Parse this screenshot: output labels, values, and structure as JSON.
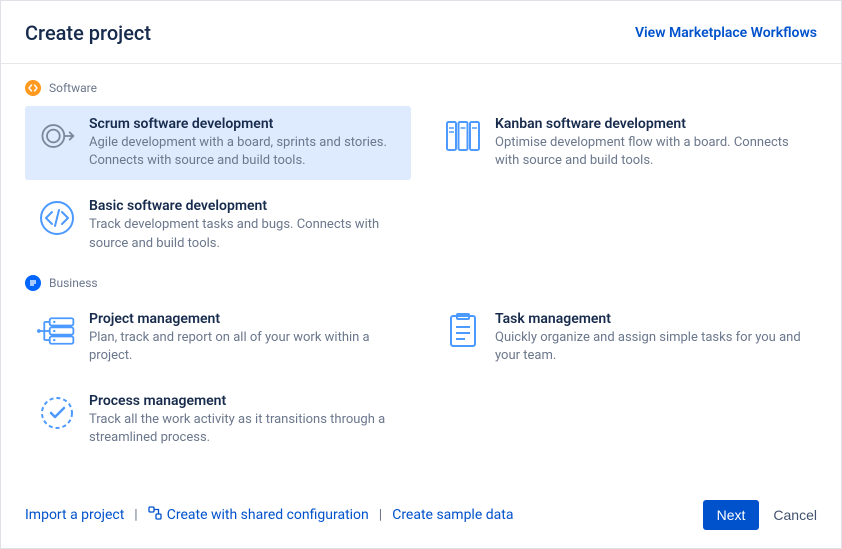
{
  "header": {
    "title": "Create project",
    "marketplaceLink": "View Marketplace Workflows"
  },
  "categories": [
    {
      "label": "Software",
      "badge": "software",
      "templates": [
        {
          "id": "scrum",
          "title": "Scrum software development",
          "desc": "Agile development with a board, sprints and stories. Connects with source and build tools.",
          "selected": true
        },
        {
          "id": "kanban",
          "title": "Kanban software development",
          "desc": "Optimise development flow with a board. Connects with source and build tools.",
          "selected": false
        },
        {
          "id": "basic",
          "title": "Basic software development",
          "desc": "Track development tasks and bugs. Connects with source and build tools.",
          "selected": false
        }
      ]
    },
    {
      "label": "Business",
      "badge": "business",
      "templates": [
        {
          "id": "project-mgmt",
          "title": "Project management",
          "desc": "Plan, track and report on all of your work within a project.",
          "selected": false
        },
        {
          "id": "task-mgmt",
          "title": "Task management",
          "desc": "Quickly organize and assign simple tasks for you and your team.",
          "selected": false
        },
        {
          "id": "process-mgmt",
          "title": "Process management",
          "desc": "Track all the work activity as it transitions through a streamlined process.",
          "selected": false
        }
      ]
    }
  ],
  "footer": {
    "import": "Import a project",
    "sharedConfig": "Create with shared configuration",
    "sampleData": "Create sample data",
    "next": "Next",
    "cancel": "Cancel"
  }
}
